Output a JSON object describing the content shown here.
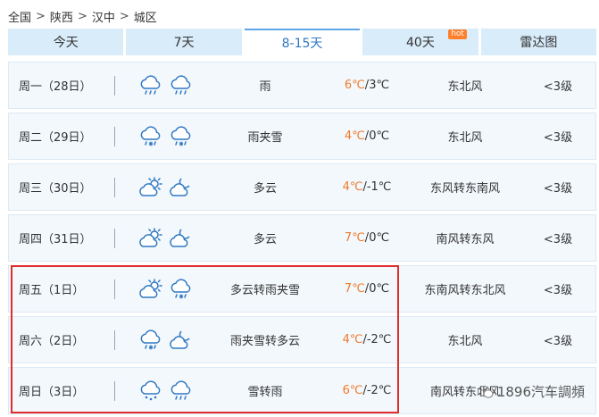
{
  "breadcrumb": [
    "全国",
    "陕西",
    "汉中",
    "城区"
  ],
  "breadcrumb_sep": ">",
  "tabs": [
    {
      "label": "今天"
    },
    {
      "label": "7天"
    },
    {
      "label": "8-15天"
    },
    {
      "label": "40天",
      "badge": "hot"
    },
    {
      "label": "雷达图"
    }
  ],
  "active_tab": 2,
  "colors": {
    "high_temp": "#f07a2b",
    "highlight_border": "#e02d2d",
    "tab_bg": "#d9ecfa",
    "row_bg": "#f3f8fc"
  },
  "rows": [
    {
      "day": "周一（28日）",
      "icons": [
        "rain-icon",
        "rain-icon"
      ],
      "condition": "雨",
      "high": "6℃",
      "low": "3℃",
      "wind": "东北风",
      "level": "<3级"
    },
    {
      "day": "周二（29日）",
      "icons": [
        "sleet-icon",
        "sleet-icon"
      ],
      "condition": "雨夹雪",
      "high": "4℃",
      "low": "0℃",
      "wind": "东北风",
      "level": "<3级"
    },
    {
      "day": "周三（30日）",
      "icons": [
        "partly-cloudy-day-icon",
        "partly-cloudy-night-icon"
      ],
      "condition": "多云",
      "high": "4℃",
      "low": "-1℃",
      "wind": "东风转东南风",
      "level": "<3级"
    },
    {
      "day": "周四（31日）",
      "icons": [
        "partly-cloudy-day-icon",
        "partly-cloudy-night-icon"
      ],
      "condition": "多云",
      "high": "7℃",
      "low": "0℃",
      "wind": "南风转东风",
      "level": "<3级"
    },
    {
      "day": "周五（1日）",
      "icons": [
        "partly-cloudy-day-icon",
        "sleet-icon"
      ],
      "condition": "多云转雨夹雪",
      "high": "7℃",
      "low": "0℃",
      "wind": "东南风转东北风",
      "level": "<3级"
    },
    {
      "day": "周六（2日）",
      "icons": [
        "sleet-icon",
        "partly-cloudy-night-icon"
      ],
      "condition": "雨夹雪转多云",
      "high": "4℃",
      "low": "-2℃",
      "wind": "东北风",
      "level": "<3级"
    },
    {
      "day": "周日（3日）",
      "icons": [
        "snow-icon",
        "rain-icon"
      ],
      "condition": "雪转雨",
      "high": "6℃",
      "low": "-2℃",
      "wind": "南风转东北风",
      "level": ""
    }
  ],
  "watermark": "1896汽车調頻"
}
